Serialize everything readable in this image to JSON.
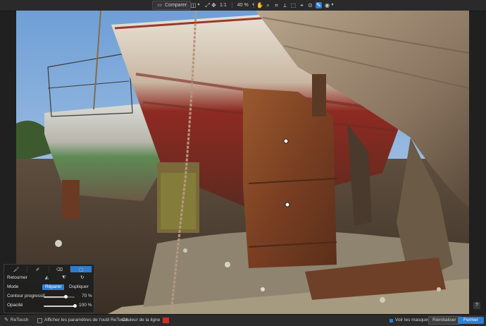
{
  "toolbar": {
    "compare_label": "Comparer",
    "zoom_ratio_label": "1:1",
    "zoom_value": "40 %"
  },
  "panel": {
    "tabs": [
      {
        "icon": "brush-icon"
      },
      {
        "icon": "stamp-brush-icon"
      },
      {
        "icon": "eraser-icon"
      },
      {
        "icon": "selection-icon"
      }
    ],
    "flip_label": "Retourner",
    "mode_label": "Mode",
    "mode_options": [
      "Réparer",
      "Dupliquer"
    ],
    "mode_selected": "Réparer",
    "feather_label": "Contour progressif",
    "feather_value": "70 %",
    "feather_level": 0.7,
    "opacity_label": "Opacité",
    "opacity_value": "100 %",
    "opacity_level": 1.0
  },
  "bottombar": {
    "tool_name": "ReTouch",
    "show_params_label": "Afficher les paramètres de l'outil ReTouch",
    "line_color_label": "Couleur de la ligne",
    "line_color": "#d42b1e",
    "show_masks_label": "Voir les masques",
    "reset_label": "Réinitialiser",
    "close_label": "Fermer"
  },
  "help_label": "?",
  "colors": {
    "accent": "#2d7fd3",
    "toolbar_bg": "#2a2a2a",
    "panel_bg": "#1e1e1e"
  }
}
